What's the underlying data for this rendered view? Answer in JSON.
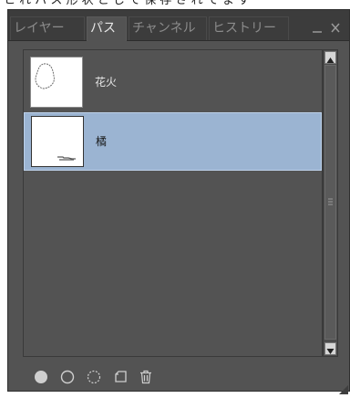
{
  "top_fragment": "ヒ    れ   パ ス    形 状 と し て 保 存 さ れ て ま す",
  "tabs": [
    {
      "label": "レイヤー"
    },
    {
      "label": "パス"
    },
    {
      "label": "チャンネル"
    },
    {
      "label": "ヒストリー"
    }
  ],
  "paths": [
    {
      "name": "花火",
      "selected": false
    },
    {
      "name": "橘",
      "selected": true
    }
  ],
  "icons": {
    "minimize": "minimize-icon",
    "close": "close-icon",
    "fill_path": "fill-path-icon",
    "stroke_path": "stroke-path-icon",
    "load_as_selection": "load-selection-icon",
    "new_path": "new-path-icon",
    "delete_path": "trash-icon"
  },
  "colors": {
    "panel_bg": "#535353",
    "tabbar_bg": "#3c3c3c",
    "selection_bg": "#9bb4d2"
  }
}
